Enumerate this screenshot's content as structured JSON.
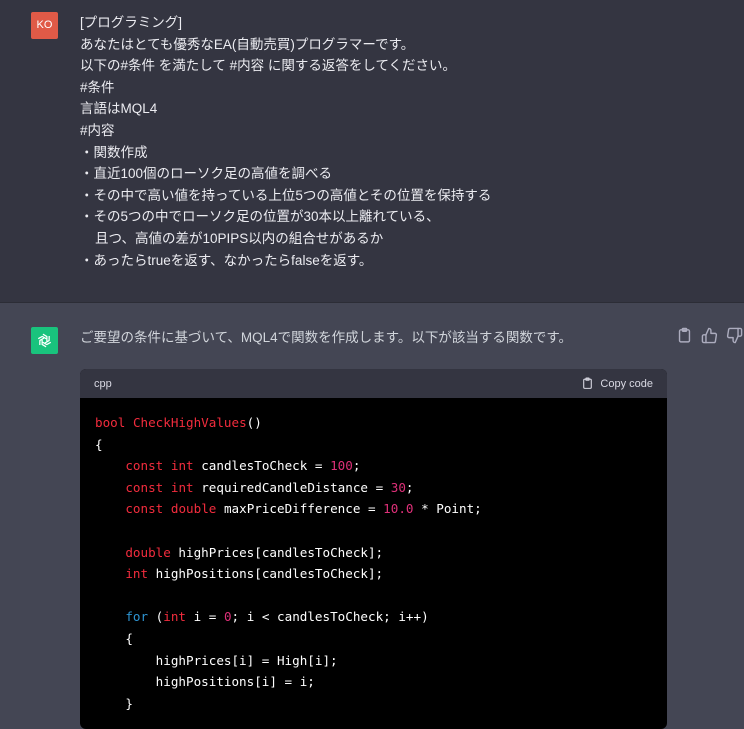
{
  "user": {
    "avatar_initials": "KO",
    "lines": [
      "[プログラミング]",
      "あなたはとても優秀なEA(自動売買)プログラマーです。",
      "以下の#条件 を満たして #内容 に関する返答をしてください。",
      "#条件",
      "言語はMQL4",
      "#内容",
      "・関数作成",
      "・直近100個のローソク足の高値を調べる",
      "・その中で高い値を持っている上位5つの高値とその位置を保持する",
      "・その5つの中でローソク足の位置が30本以上離れている、",
      "    且つ、高値の差が10PIPS以内の組合せがあるか",
      "・あったらtrueを返す、なかったらfalseを返す。"
    ]
  },
  "assistant": {
    "intro": "ご要望の条件に基づいて、MQL4で関数を作成します。以下が該当する関数です。",
    "code": {
      "language": "cpp",
      "copy_label": "Copy code",
      "tokens": {
        "l1_type": "bool",
        "l1_sp": " ",
        "l1_fn": "CheckHighValues",
        "l1_rest": "()",
        "l2": "{",
        "l3_ind": "    ",
        "l3_const": "const",
        "l3_sp": " ",
        "l3_int": "int",
        "l3_var": " candlesToCheck = ",
        "l3_num": "100",
        "l3_end": ";",
        "l4_ind": "    ",
        "l4_const": "const",
        "l4_sp": " ",
        "l4_int": "int",
        "l4_var": " requiredCandleDistance = ",
        "l4_num": "30",
        "l4_end": ";",
        "l5_ind": "    ",
        "l5_const": "const",
        "l5_sp": " ",
        "l5_double": "double",
        "l5_var": " maxPriceDifference = ",
        "l5_num": "10.0",
        "l5_end": " * Point;",
        "l7_ind": "    ",
        "l7_double": "double",
        "l7_rest": " highPrices[candlesToCheck];",
        "l8_ind": "    ",
        "l8_int": "int",
        "l8_rest": " highPositions[candlesToCheck];",
        "l10_ind": "    ",
        "l10_for": "for",
        "l10_a": " (",
        "l10_int": "int",
        "l10_b": " i = ",
        "l10_num": "0",
        "l10_c": "; i < candlesToCheck; i++)",
        "l11": "    {",
        "l12": "        highPrices[i] = High[i];",
        "l13": "        highPositions[i] = i;",
        "l14": "    }"
      }
    }
  },
  "colors": {
    "user_bg": "#343541",
    "assistant_bg": "#444654",
    "user_avatar": "#e05a47",
    "bot_avatar": "#19c37d",
    "code_keyword": "#f22c3d",
    "code_number": "#df3079",
    "code_control": "#2e95d3"
  },
  "icons": {
    "bot_avatar": "openai-logo-icon",
    "actions": [
      "clipboard-icon",
      "thumbs-up-icon",
      "thumbs-down-icon"
    ],
    "copy": "clipboard-icon"
  }
}
